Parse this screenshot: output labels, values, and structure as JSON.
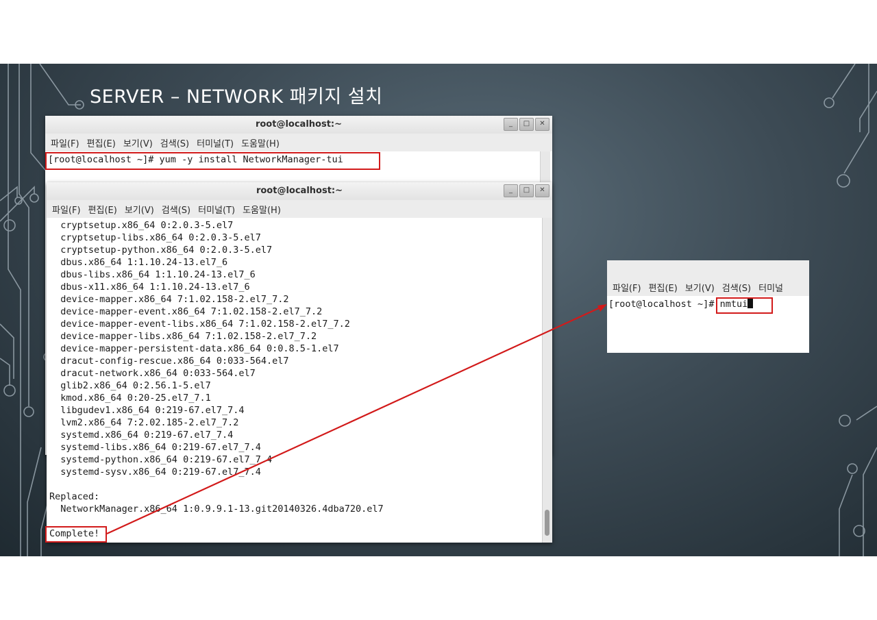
{
  "slide": {
    "title": "SERVER – NETWORK 패키지 설치"
  },
  "window1": {
    "title": "root@localhost:~",
    "menu": [
      "파일(F)",
      "편집(E)",
      "보기(V)",
      "검색(S)",
      "터미널(T)",
      "도움말(H)"
    ],
    "command": "[root@localhost ~]# yum -y install NetworkManager-tui"
  },
  "window2": {
    "title": "root@localhost:~",
    "menu": [
      "파일(F)",
      "편집(E)",
      "보기(V)",
      "검색(S)",
      "터미널(T)",
      "도움말(H)"
    ],
    "lines": [
      "  cryptsetup.x86_64 0:2.0.3-5.el7",
      "  cryptsetup-libs.x86_64 0:2.0.3-5.el7",
      "  cryptsetup-python.x86_64 0:2.0.3-5.el7",
      "  dbus.x86_64 1:1.10.24-13.el7_6",
      "  dbus-libs.x86_64 1:1.10.24-13.el7_6",
      "  dbus-x11.x86_64 1:1.10.24-13.el7_6",
      "  device-mapper.x86_64 7:1.02.158-2.el7_7.2",
      "  device-mapper-event.x86_64 7:1.02.158-2.el7_7.2",
      "  device-mapper-event-libs.x86_64 7:1.02.158-2.el7_7.2",
      "  device-mapper-libs.x86_64 7:1.02.158-2.el7_7.2",
      "  device-mapper-persistent-data.x86_64 0:0.8.5-1.el7",
      "  dracut-config-rescue.x86_64 0:033-564.el7",
      "  dracut-network.x86_64 0:033-564.el7",
      "  glib2.x86_64 0:2.56.1-5.el7",
      "  kmod.x86_64 0:20-25.el7_7.1",
      "  libgudev1.x86_64 0:219-67.el7_7.4",
      "  lvm2.x86_64 7:2.02.185-2.el7_7.2",
      "  systemd.x86_64 0:219-67.el7_7.4",
      "  systemd-libs.x86_64 0:219-67.el7_7.4",
      "  systemd-python.x86_64 0:219-67.el7_7.4",
      "  systemd-sysv.x86_64 0:219-67.el7_7.4",
      "",
      "Replaced:",
      "  NetworkManager.x86_64 1:0.9.9.1-13.git20140326.4dba720.el7",
      "",
      "Complete!"
    ]
  },
  "window3": {
    "menu": [
      "파일(F)",
      "편집(E)",
      "보기(V)",
      "검색(S)",
      "터미널"
    ],
    "prompt": "[root@localhost ~]",
    "command": "# nmtui"
  },
  "colors": {
    "highlight": "#d21a1a",
    "background": "#3d4b55"
  }
}
